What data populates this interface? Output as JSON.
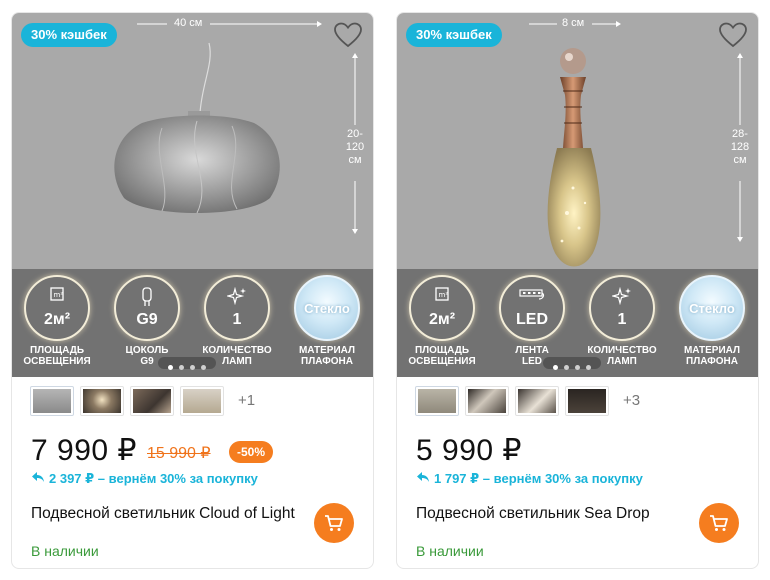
{
  "products": [
    {
      "cashback_badge": "30% кэшбек",
      "dim_width": "40 см",
      "dim_height_lines": [
        "20-",
        "120",
        "см"
      ],
      "features": [
        {
          "value": "2м²",
          "icon": "area-icon",
          "label_lines": [
            "ПЛОЩАДЬ",
            "ОСВЕЩЕНИЯ"
          ]
        },
        {
          "value": "G9",
          "icon": "bulb-socket-icon",
          "label_lines": [
            "ЦОКОЛЬ",
            "G9"
          ]
        },
        {
          "value": "1",
          "icon": "sparkle-icon",
          "label_lines": [
            "КОЛИЧЕСТВО",
            "ЛАМП"
          ]
        },
        {
          "value": "Стекло",
          "icon": "glass-icon",
          "label_lines": [
            "МАТЕРИАЛ",
            "ПЛАФОНА"
          ]
        }
      ],
      "more_photos": "+1",
      "price": "7 990 ₽",
      "old_price": "15 990 ₽",
      "discount": "-50%",
      "cashback_text": "2 397 ₽ – вернём 30% за покупку",
      "title": "Подвесной светильник Cloud of Light",
      "stock": "В наличии"
    },
    {
      "cashback_badge": "30% кэшбек",
      "dim_width": "8 см",
      "dim_height_lines": [
        "28-",
        "128",
        "см"
      ],
      "features": [
        {
          "value": "2м²",
          "icon": "area-icon",
          "label_lines": [
            "ПЛОЩАДЬ",
            "ОСВЕЩЕНИЯ"
          ]
        },
        {
          "value": "LED",
          "icon": "led-strip-icon",
          "label_lines": [
            "ЛЕНТА",
            "LED"
          ]
        },
        {
          "value": "1",
          "icon": "sparkle-icon",
          "label_lines": [
            "КОЛИЧЕСТВО",
            "ЛАМП"
          ]
        },
        {
          "value": "Стекло",
          "icon": "glass-icon",
          "label_lines": [
            "МАТЕРИАЛ",
            "ПЛАФОНА"
          ]
        }
      ],
      "more_photos": "+3",
      "price": "5 990 ₽",
      "cashback_text": "1 797 ₽ – вернём 30% за покупку",
      "title": "Подвесной светильник Sea Drop",
      "stock": "В наличии"
    }
  ],
  "colors": {
    "accent_orange": "#f57d1f",
    "accent_blue": "#1ab4d9",
    "in_stock_green": "#3a9a3a"
  }
}
